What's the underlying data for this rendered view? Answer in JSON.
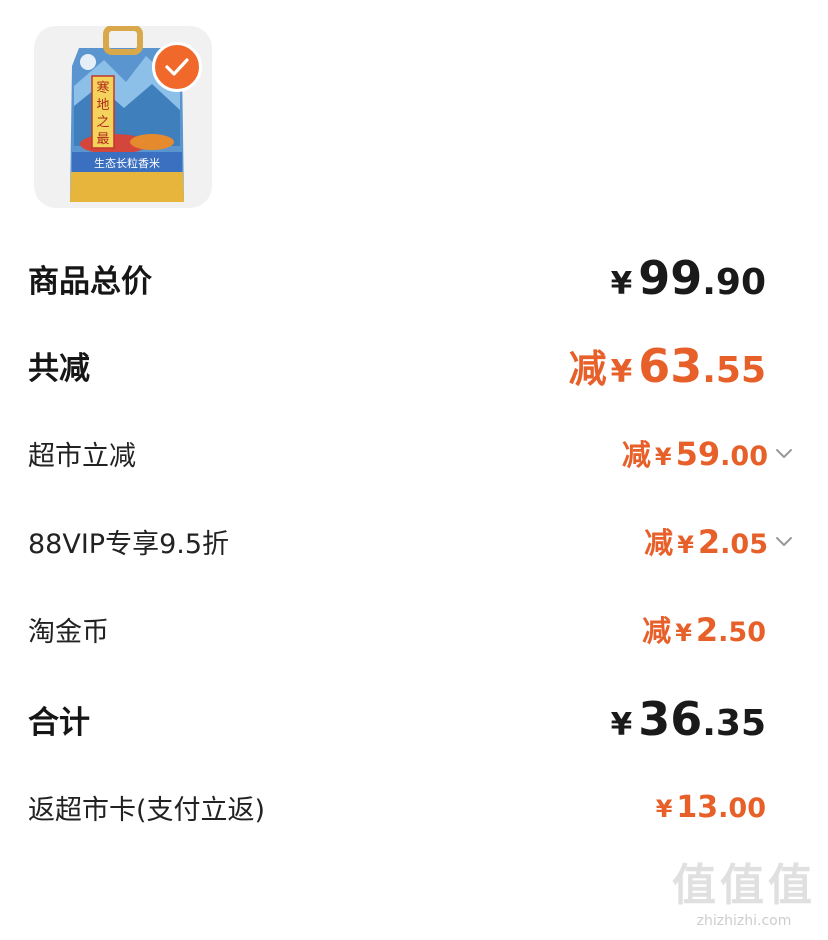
{
  "product": {
    "image_label_main": "寒地之最",
    "image_label_sub": "生态长粒香米",
    "selected": true,
    "check_color": "#f0692b"
  },
  "rows": [
    {
      "label": "商品总价",
      "prefix": "",
      "currency": "¥",
      "int": "99",
      "dec": ".90",
      "style": "total",
      "chevron": false
    },
    {
      "label": "共减",
      "prefix": "减",
      "currency": "¥",
      "int": "63",
      "dec": ".55",
      "style": "discount-total",
      "chevron": false
    },
    {
      "label": "超市立减",
      "prefix": "减",
      "currency": "¥",
      "int": "59",
      "dec": ".00",
      "style": "discount",
      "chevron": true
    },
    {
      "label": "88VIP专享9.5折",
      "prefix": "减",
      "currency": "¥",
      "int": "2",
      "dec": ".05",
      "style": "discount",
      "chevron": true
    },
    {
      "label": "淘金币",
      "prefix": "减",
      "currency": "¥",
      "int": "2",
      "dec": ".50",
      "style": "discount",
      "chevron": false
    },
    {
      "label": "合计",
      "prefix": "",
      "currency": "¥",
      "int": "36",
      "dec": ".35",
      "style": "total",
      "chevron": false
    },
    {
      "label": "返超市卡(支付立返)",
      "prefix": "",
      "currency": "¥",
      "int": "13",
      "dec": ".00",
      "style": "rebate",
      "chevron": false
    }
  ],
  "colors": {
    "accent": "#e7602a",
    "text": "#1a1a1a",
    "chevron": "#9a9a9a"
  },
  "watermark": {
    "big": "值值值",
    "small": "zhizhizhi.com"
  }
}
